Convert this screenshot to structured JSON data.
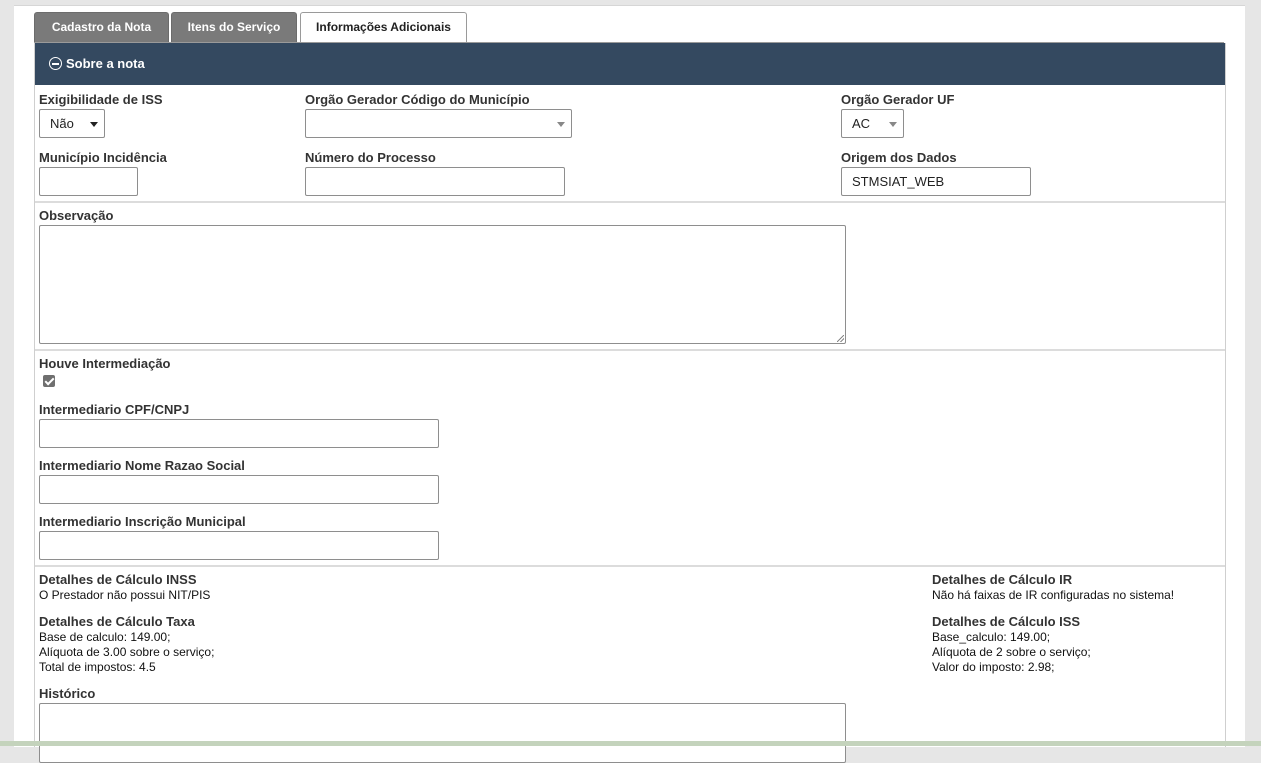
{
  "tabs": [
    {
      "label": "Cadastro da Nota"
    },
    {
      "label": "Itens do Serviço"
    },
    {
      "label": "Informações Adicionais"
    }
  ],
  "panel": {
    "title": "Sobre a nota"
  },
  "fields": {
    "exigibilidade": {
      "label": "Exigibilidade de ISS",
      "value": "Não"
    },
    "orgao_municipio": {
      "label": "Orgão Gerador Código do Município",
      "value": ""
    },
    "orgao_uf": {
      "label": "Orgão Gerador UF",
      "value": "AC"
    },
    "municipio_incidencia": {
      "label": "Município Incidência",
      "value": ""
    },
    "numero_processo": {
      "label": "Número do Processo",
      "value": ""
    },
    "origem_dados": {
      "label": "Origem dos Dados",
      "value": "STMSIAT_WEB"
    },
    "observacao": {
      "label": "Observação"
    },
    "houve_intermediacao": {
      "label": "Houve Intermediação",
      "checked": true
    },
    "intermediario_cpf": {
      "label": "Intermediario CPF/CNPJ",
      "value": ""
    },
    "intermediario_nome": {
      "label": "Intermediario Nome Razao Social",
      "value": ""
    },
    "intermediario_inscricao": {
      "label": "Intermediario Inscrição Municipal",
      "value": ""
    },
    "historico": {
      "label": "Histórico"
    }
  },
  "calculos": {
    "inss": {
      "title": "Detalhes de Cálculo INSS",
      "lines": [
        "O Prestador não possui NIT/PIS"
      ]
    },
    "ir": {
      "title": "Detalhes de Cálculo IR",
      "lines": [
        "Não há faixas de IR configuradas no sistema!"
      ]
    },
    "taxa": {
      "title": "Detalhes de Cálculo Taxa",
      "lines": [
        "Base de calculo: 149.00;",
        "Alíquota de 3.00 sobre o serviço;",
        "Total de impostos: 4.5"
      ]
    },
    "iss": {
      "title": "Detalhes de Cálculo ISS",
      "lines": [
        "Base_calculo: 149.00;",
        "Alíquota de 2 sobre o serviço;",
        "Valor do imposto: 2.98;"
      ]
    }
  },
  "colors": {
    "header_bg": "#344960",
    "tab_inactive": "#7a7a7a"
  }
}
